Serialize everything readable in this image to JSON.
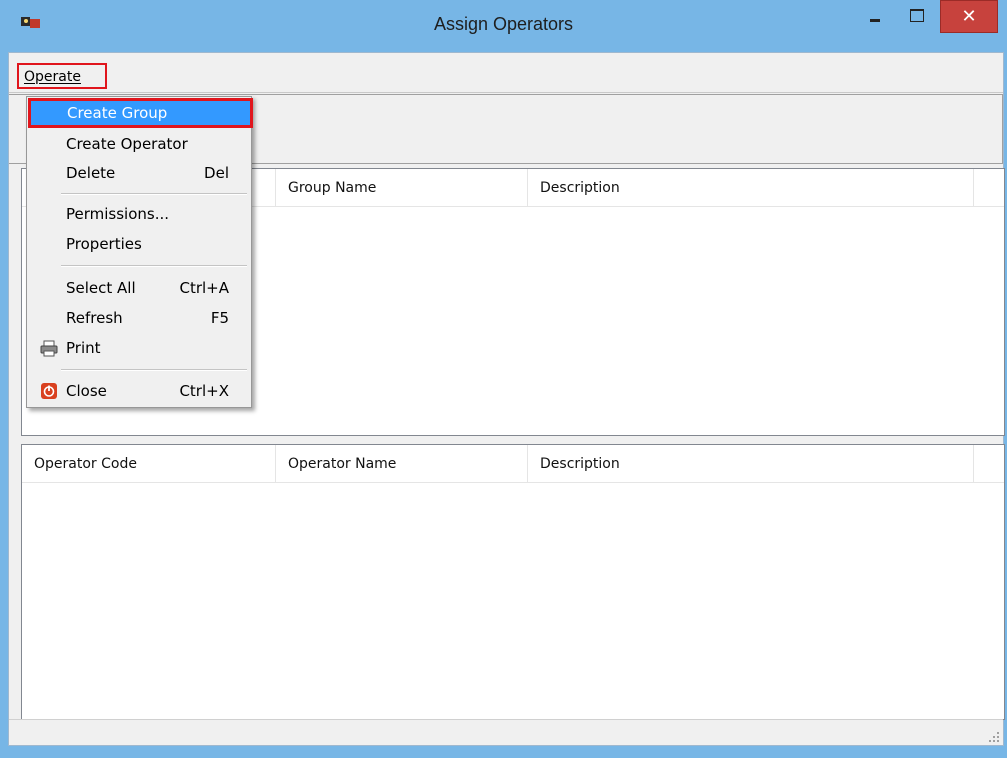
{
  "window": {
    "title": "Assign Operators"
  },
  "menubar": {
    "operate_label": "Operate"
  },
  "menu": {
    "items": [
      {
        "label": "Create Group",
        "shortcut": ""
      },
      {
        "label": "Create Operator",
        "shortcut": ""
      },
      {
        "label": "Delete",
        "shortcut": "Del"
      },
      {
        "label": "Permissions...",
        "shortcut": ""
      },
      {
        "label": "Properties",
        "shortcut": ""
      },
      {
        "label": "Select All",
        "shortcut": "Ctrl+A"
      },
      {
        "label": "Refresh",
        "shortcut": "F5"
      },
      {
        "label": "Print",
        "shortcut": ""
      },
      {
        "label": "Close",
        "shortcut": "Ctrl+X"
      }
    ]
  },
  "groups_grid": {
    "columns": [
      "",
      "Group Name",
      "Description"
    ],
    "rows": []
  },
  "operators_grid": {
    "columns": [
      "Operator Code",
      "Operator Name",
      "Description"
    ],
    "rows": []
  },
  "colors": {
    "titlebar": "#77b6e6",
    "highlight": "#3399ff",
    "annotation": "#e0151c",
    "close_button": "#c7423d"
  },
  "icons": {
    "app": "app-icon",
    "print": "printer-icon",
    "close": "power-icon"
  }
}
